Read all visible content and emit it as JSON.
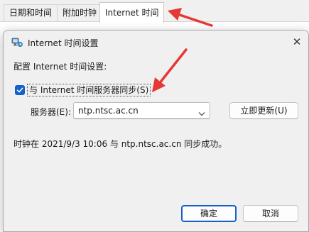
{
  "parent_window": {
    "tabs": [
      {
        "label": "日期和时间"
      },
      {
        "label": "附加时钟"
      },
      {
        "label": "Internet 时间"
      }
    ]
  },
  "dialog": {
    "title": "Internet 时间设置",
    "section_label": "配置 Internet 时间设置:",
    "sync_checkbox": {
      "checked": true,
      "label": "与 Internet 时间服务器同步(S)"
    },
    "server": {
      "label": "服务器(E):",
      "value": "ntp.ntsc.ac.cn"
    },
    "update_now_button": "立即更新(U)",
    "status_text": "时钟在 2021/9/3 10:06 与 ntp.ntsc.ac.cn 同步成功。",
    "ok_button": "确定",
    "cancel_button": "取消"
  },
  "colors": {
    "accent": "#1560c9",
    "annotation_arrow": "#e53935",
    "dialog_bg": "#f0f0f0"
  },
  "icons": {
    "title_icon": "computer-network-icon",
    "close_icon": "close-icon",
    "check_icon": "checkmark-icon",
    "combo_icon": "chevron-down-icon"
  }
}
